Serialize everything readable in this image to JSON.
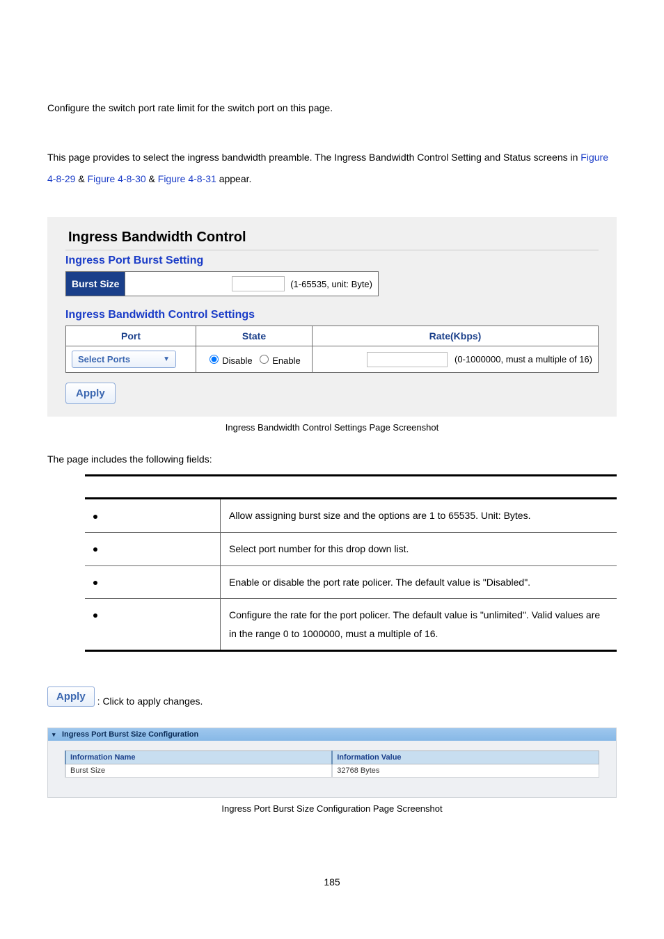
{
  "intro": {
    "line1": "Configure the switch port rate limit for the switch port on this page.",
    "line2_pre": "This page provides to select the ingress bandwidth preamble. The Ingress Bandwidth Control Setting and Status screens in ",
    "fig1": "Figure 4-8-29",
    "amp": " & ",
    "fig2": "Figure 4-8-30",
    "fig3": "Figure 4-8-31",
    "appear": " appear."
  },
  "shot1": {
    "title": "Ingress Bandwidth Control",
    "burst_heading": "Ingress Port Burst Setting",
    "burst_label": "Burst Size",
    "burst_hint": "(1-65535, unit: Byte)",
    "ctrl_heading": "Ingress Bandwidth Control Settings",
    "cols": {
      "port": "Port",
      "state": "State",
      "rate": "Rate(Kbps)"
    },
    "select_ports": "Select Ports",
    "disable": "Disable",
    "enable": "Enable",
    "rate_hint": "(0-1000000, must a multiple of 16)",
    "apply": "Apply"
  },
  "caption1": "Ingress Bandwidth Control Settings Page Screenshot",
  "fields_intro": "The page includes the following fields:",
  "fields": {
    "r1": "Allow assigning burst size and the options are 1 to 65535. Unit: Bytes.",
    "r2": "Select port number for this drop down list.",
    "r3": "Enable or disable the port rate policer. The default value is \"Disabled\".",
    "r4": "Configure the rate for the port policer. The default value is \"unlimited\". Valid values are in the range 0 to 1000000, must a multiple of 16."
  },
  "apply_note": {
    "btn": "Apply",
    "text": ": Click to apply changes."
  },
  "shot2": {
    "header": "Ingress Port Burst Size Configuration",
    "col_name": "Information Name",
    "col_value": "Information Value",
    "row_name": "Burst Size",
    "row_value": "32768 Bytes"
  },
  "caption2": "Ingress Port Burst Size Configuration Page Screenshot",
  "pagenum": "185"
}
